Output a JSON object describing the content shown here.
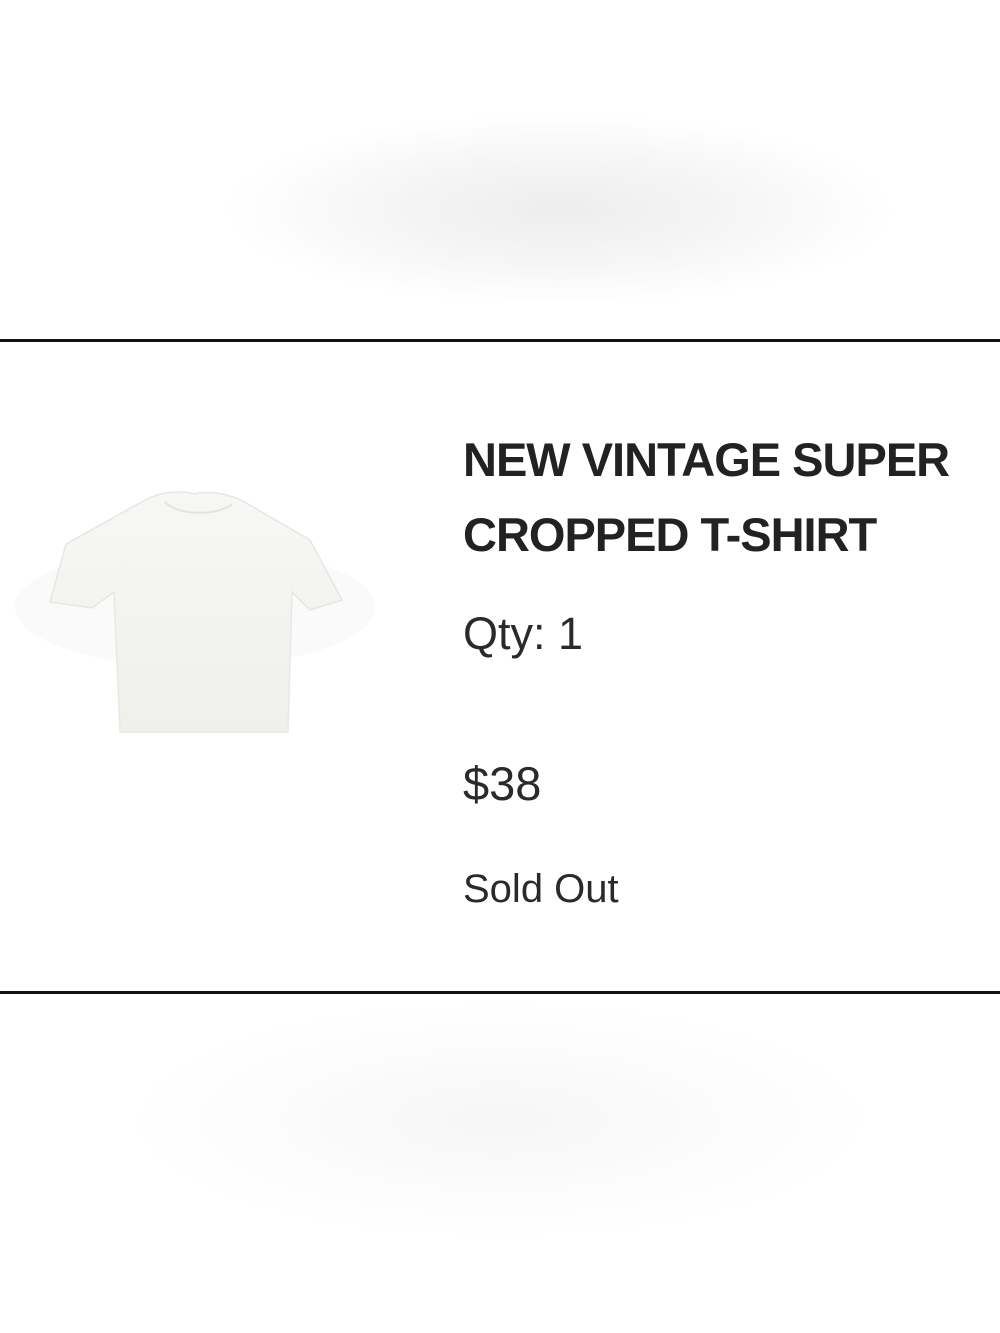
{
  "product": {
    "title": "NEW VINTAGE SUPER\nCROPPED T-SHIRT",
    "qty_label": "Qty: 1",
    "price": "$38",
    "status": "Sold Out",
    "image_icon": "white-cropped-tshirt"
  }
}
